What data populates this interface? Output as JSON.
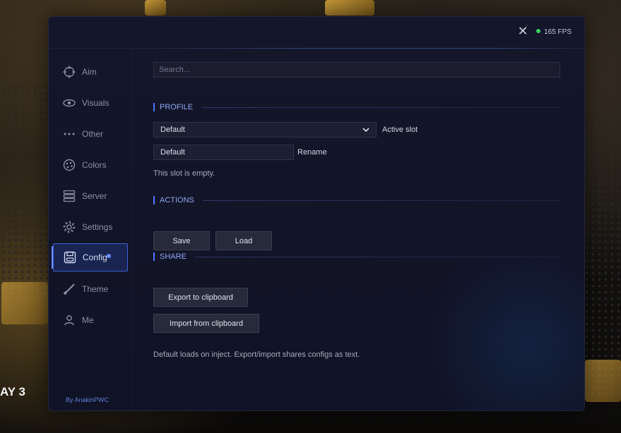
{
  "background": {
    "overlay_text": "AY 3"
  },
  "header": {
    "close_icon": "close-icon",
    "fps_label": "165 FPS",
    "fps_status_color": "#38d15c"
  },
  "sidebar": {
    "items": [
      {
        "label": "Aim",
        "icon": "crosshair-icon"
      },
      {
        "label": "Visuals",
        "icon": "eye-icon"
      },
      {
        "label": "Other",
        "icon": "dots-icon"
      },
      {
        "label": "Colors",
        "icon": "palette-icon"
      },
      {
        "label": "Server",
        "icon": "server-icon"
      },
      {
        "label": "Settings",
        "icon": "gear-icon"
      },
      {
        "label": "Config",
        "icon": "save-icon",
        "active": true
      },
      {
        "label": "Theme",
        "icon": "brush-icon"
      },
      {
        "label": "Me",
        "icon": "user-icon"
      }
    ],
    "credit": "By AnakinPWC"
  },
  "search": {
    "placeholder": "Search..."
  },
  "profile": {
    "section_label": "PROFILE",
    "slot_value": "Default",
    "slot_label": "Active slot",
    "rename_value": "Default",
    "rename_label": "Rename",
    "empty_text": "This slot is empty."
  },
  "actions": {
    "section_label": "ACTIONS",
    "save_label": "Save",
    "load_label": "Load"
  },
  "share": {
    "section_label": "SHARE",
    "export_label": "Export to clipboard",
    "import_label": "Import from clipboard"
  },
  "footer_note": "Default loads on inject. Export/import shares configs as text.",
  "colors": {
    "accent": "#4c78ff",
    "active_bg": "#1a2450",
    "panel_bg": "#14162a"
  }
}
